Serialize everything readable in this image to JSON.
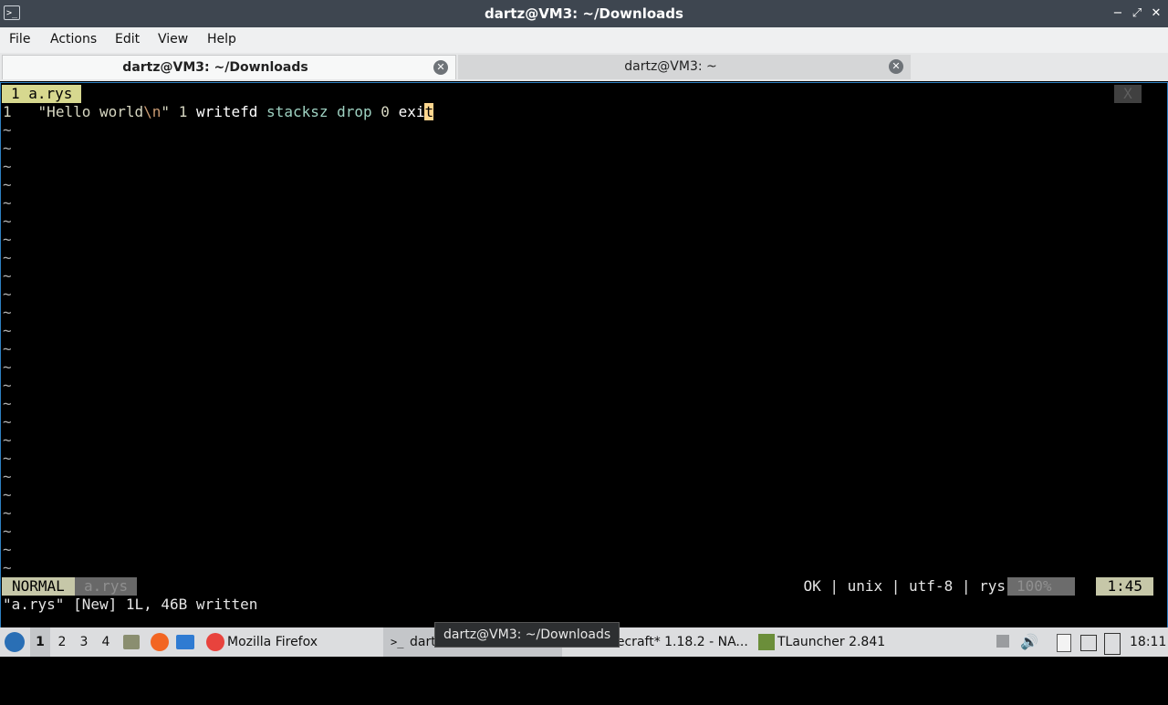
{
  "window": {
    "title": "dartz@VM3: ~/Downloads",
    "minimize_glyph": "−",
    "maximize_glyph": "⤢",
    "close_glyph": "✕"
  },
  "menu": [
    "File",
    "Actions",
    "Edit",
    "View",
    "Help"
  ],
  "tabs": [
    {
      "label": "dartz@VM3: ~/Downloads",
      "active": true
    },
    {
      "label": "dartz@VM3: ~",
      "active": false
    }
  ],
  "vim": {
    "tabline": "1 a.rys",
    "tabline_close": "X",
    "line_number": "1",
    "code": {
      "str_open": "\"Hello world",
      "escape": "\\n",
      "str_close": "\"",
      "num1": "1",
      "writefd": "writefd",
      "stacksz": "stacksz",
      "drop": "drop",
      "num2": "0",
      "exit_head": "exi",
      "exit_cursor": "t"
    },
    "tilde": "~",
    "tilde_rows": 25,
    "status": {
      "mode": "NORMAL",
      "file": "a.rys",
      "info": "OK | unix | utf-8 | rys",
      "percent": "100%",
      "position": "1:45"
    },
    "message": "\"a.rys\" [New] 1L, 46B written"
  },
  "taskbar": {
    "workspaces": [
      "1",
      "2",
      "3",
      "4"
    ],
    "active_workspace": "1",
    "firefox_label": "Mozilla Firefox",
    "terminal_label": "dartz@VM3: ~/Downloads",
    "terminal_short": "dart",
    "minecraft_label": "necraft* 1.18.2 - NA...",
    "tlauncher_label": "TLauncher 2.841",
    "clock": "18:11"
  },
  "tooltip": "dartz@VM3: ~/Downloads"
}
